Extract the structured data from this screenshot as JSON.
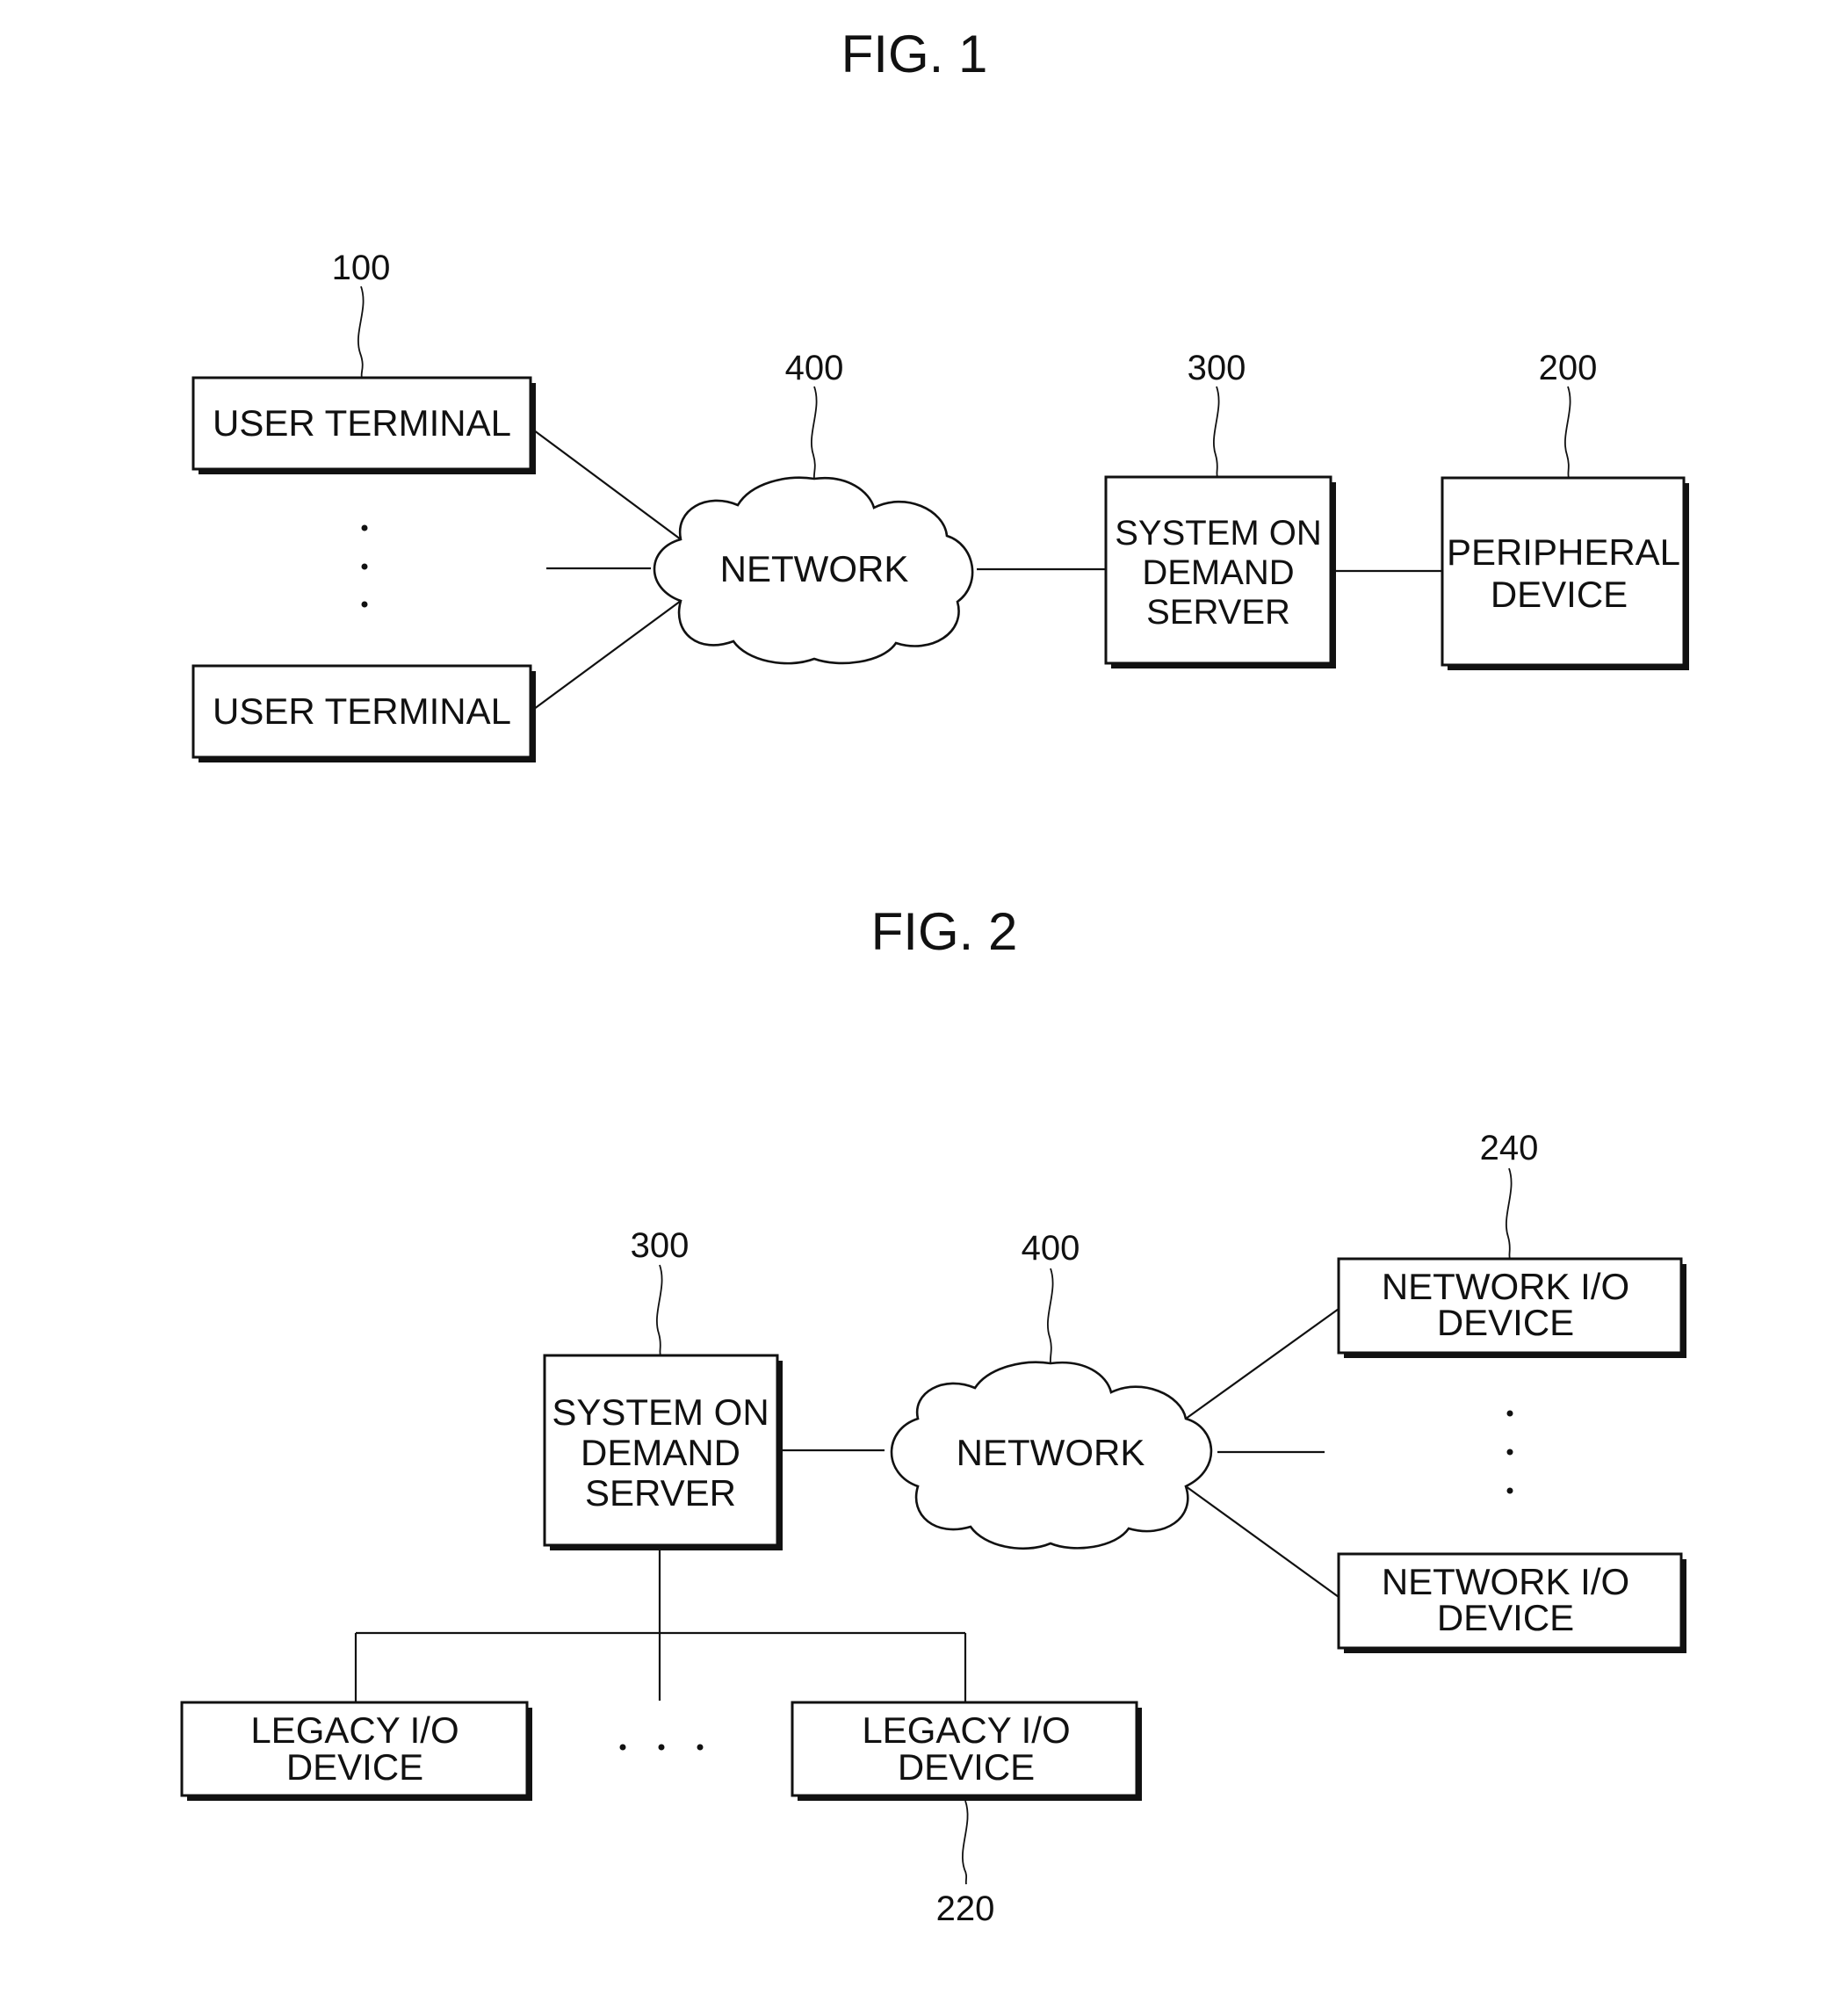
{
  "figures": [
    {
      "title": "FIG. 1",
      "nodes": {
        "user_terminal_1": {
          "lines": [
            "USER TERMINAL"
          ],
          "ref": "100"
        },
        "user_terminal_2": {
          "lines": [
            "USER TERMINAL"
          ]
        },
        "network": {
          "lines": [
            "NETWORK"
          ],
          "ref": "400"
        },
        "server": {
          "lines": [
            "SYSTEM ON",
            "DEMAND",
            "SERVER"
          ],
          "ref": "300"
        },
        "peripheral": {
          "lines": [
            "PERIPHERAL",
            "DEVICE"
          ],
          "ref": "200"
        }
      },
      "ellipsis": "⋮"
    },
    {
      "title": "FIG. 2",
      "nodes": {
        "server": {
          "lines": [
            "SYSTEM ON",
            "DEMAND",
            "SERVER"
          ],
          "ref": "300"
        },
        "network": {
          "lines": [
            "NETWORK"
          ],
          "ref": "400"
        },
        "net_io_1": {
          "lines": [
            "NETWORK I/O",
            "DEVICE"
          ],
          "ref": "240"
        },
        "net_io_2": {
          "lines": [
            "NETWORK I/O",
            "DEVICE"
          ]
        },
        "legacy_1": {
          "lines": [
            "LEGACY I/O",
            "DEVICE"
          ]
        },
        "legacy_2": {
          "lines": [
            "LEGACY I/O",
            "DEVICE"
          ],
          "ref": "220"
        }
      }
    }
  ]
}
